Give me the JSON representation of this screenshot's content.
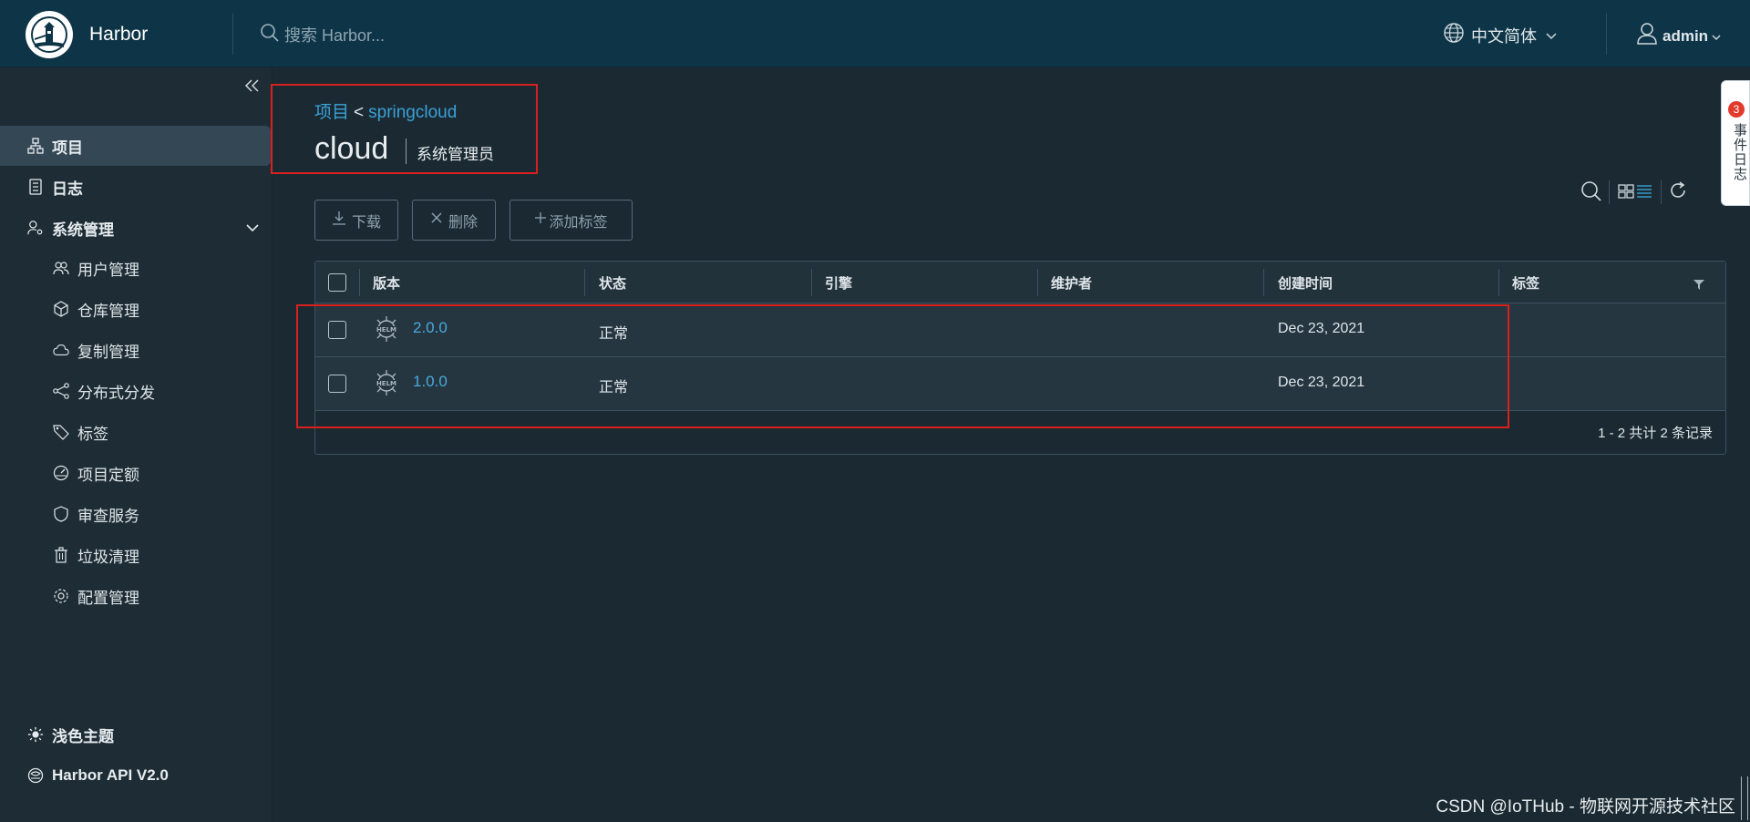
{
  "header": {
    "app_name": "Harbor",
    "search_placeholder": "搜索 Harbor...",
    "language": "中文简体",
    "user": "admin"
  },
  "sidebar": {
    "items": [
      {
        "label": "项目",
        "icon": "project-icon",
        "active": true
      },
      {
        "label": "日志",
        "icon": "log-icon"
      },
      {
        "label": "系统管理",
        "icon": "admin-icon",
        "expanded": true
      }
    ],
    "sub_items": [
      {
        "label": "用户管理",
        "icon": "users-icon"
      },
      {
        "label": "仓库管理",
        "icon": "registry-icon"
      },
      {
        "label": "复制管理",
        "icon": "replication-icon"
      },
      {
        "label": "分布式分发",
        "icon": "distribution-icon"
      },
      {
        "label": "标签",
        "icon": "tag-icon"
      },
      {
        "label": "项目定额",
        "icon": "quota-icon"
      },
      {
        "label": "审查服务",
        "icon": "shield-icon"
      },
      {
        "label": "垃圾清理",
        "icon": "trash-icon"
      },
      {
        "label": "配置管理",
        "icon": "gear-icon"
      }
    ],
    "footer": {
      "theme": "浅色主题",
      "api": "Harbor API V2.0"
    }
  },
  "breadcrumb": {
    "root": "项目",
    "separator": "<",
    "project": "springcloud"
  },
  "page": {
    "title": "cloud",
    "role": "系统管理员"
  },
  "actions": {
    "download": "下载",
    "delete": "删除",
    "add_label": "添加标签"
  },
  "table": {
    "columns": [
      "版本",
      "状态",
      "引擎",
      "维护者",
      "创建时间",
      "标签"
    ],
    "rows": [
      {
        "version": "2.0.0",
        "status": "正常",
        "engine": "",
        "maintainer": "",
        "created": "Dec 23, 2021",
        "labels": ""
      },
      {
        "version": "1.0.0",
        "status": "正常",
        "engine": "",
        "maintainer": "",
        "created": "Dec 23, 2021",
        "labels": ""
      }
    ],
    "footer": "1 - 2 共计 2 条记录",
    "helm_icon_text": "HELM"
  },
  "event_tab": {
    "badge": "3",
    "label": "事件日志"
  },
  "watermark": "CSDN @IoTHub - 物联网开源技术社区",
  "colors": {
    "header_bg": "#0e3547",
    "sidebar_bg": "#1e2c35",
    "content_bg": "#1b2a32",
    "link": "#3aa1d8",
    "highlight": "#d9201c"
  }
}
